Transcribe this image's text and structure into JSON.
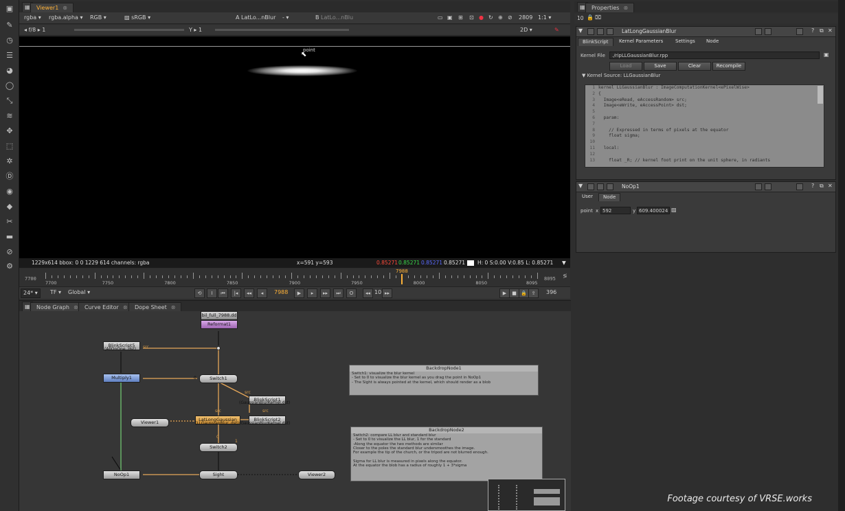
{
  "viewer": {
    "tab": "Viewer1",
    "layer": "rgba",
    "channel": "rgba.alpha",
    "display": "RGB",
    "lut": "sRGB",
    "input_a_label": "A",
    "input_a": "LatLo...nBlur",
    "input_a_op": "-",
    "input_b_label": "B",
    "input_b": "LatLo...nBlu",
    "fstop": "f/8",
    "gain": "1",
    "gamma_label": "Y",
    "gamma": "1",
    "frame_val": "2809",
    "zoom": "1:1",
    "mode": "2D",
    "point_label": "point",
    "info_format": "1229x614  bbox: 0 0 1229 614 channels: rgba",
    "info_xy": "x=591 y=593",
    "info_r": "0.85271",
    "info_g": "0.85271",
    "info_b": "0.85271",
    "info_a": "0.85271",
    "info_hsv": "H:  0 S:0.00 V:0.85  L: 0.85271",
    "colors": {
      "r": "#ff4b3a",
      "g": "#39d94a",
      "b": "#5a6bff",
      "accent": "#ffb238"
    }
  },
  "timeline": {
    "start": "7700",
    "end": "8095",
    "ticks": [
      "7700",
      "7750",
      "7800",
      "7850",
      "7900",
      "7950",
      "8000",
      "8050",
      "8095"
    ],
    "current": "7988",
    "fps": "24*",
    "tf": "TF",
    "scope": "Global",
    "current_frame": "7988",
    "step": "10",
    "end_frame": "396"
  },
  "nodegraph_tabs": [
    {
      "label": "Node Graph"
    },
    {
      "label": "Curve Editor"
    },
    {
      "label": "Dope Sheet"
    }
  ],
  "nodes": {
    "read": "bil_full_7988.dd",
    "reformat": "Reformat1",
    "blink5": "BlinkScript5",
    "blink5_sub": "(AllOnOne..dst)",
    "multiply": "Multiply1",
    "switch1": "Switch1",
    "blink1": "BlinkScript1",
    "blink1_sub": "(GaussianBlurKernel.dst)",
    "viewer1": "Viewer1",
    "latlong": "LatLongGaussian",
    "latlong_sub": "(LLGaussianBlur..dst)",
    "blink2": "BlinkScript2",
    "blink2_sub": "(GaussianBlurKernel.dst)",
    "switch2": "Switch2",
    "noop": "NoOp1",
    "sight": "Sight",
    "viewer2": "Viewer2",
    "src_label": "src",
    "zero_label": "0",
    "one_label": "1"
  },
  "backdrop1": {
    "title": "BackdropNode1",
    "lines": [
      "Switch1: visualize the blur kernel",
      "- Set to 0 to visualize the blur kernel as you drag the point in NoOp1",
      "- The Sight is always pointed at the kernel, which should render as a blob"
    ]
  },
  "backdrop2": {
    "title": "BackdropNode2",
    "lines": [
      "Switch2: compare LL blur and standard blur",
      "- Set to 0 to visualize the LL blur, 1 for the standard",
      "-Along the equator the two methods are similar",
      "Closer to the poles the standard blur undersmoothes the image.",
      "For example the tip of the church, or the tripod are not blurred enough.",
      "",
      "Sigma for LL blur is measured in pixels along the equator.",
      "At the equator the blob has a radius of roughly 1 + 3*sigma"
    ]
  },
  "properties": {
    "tab": "Properties",
    "count": "10",
    "panel1": {
      "name": "LatLongGaussianBlur",
      "tabs": [
        "BlinkScript",
        "Kernel Parameters",
        "Settings",
        "Node"
      ],
      "kernel_file_label": "Kernel File",
      "kernel_file": "./ripLLGaussianBlur.rpp",
      "buttons": [
        "Load",
        "Save",
        "Clear",
        "Recompile"
      ],
      "kernel_source_label": "Kernel Source: LLGaussianBlur",
      "code": [
        {
          "n": "1",
          "t": "kernel LLGaussianBlur : ImageComputationKernel<ePixelWise>"
        },
        {
          "n": "2",
          "t": "{"
        },
        {
          "n": "3",
          "t": "  Image<eRead, eAccessRandom> src;"
        },
        {
          "n": "4",
          "t": "  Image<eWrite, eAccessPoint> dst;"
        },
        {
          "n": "5",
          "t": ""
        },
        {
          "n": "6",
          "t": "  param:"
        },
        {
          "n": "7",
          "t": ""
        },
        {
          "n": "8",
          "t": "    // Expressed in terms of pixels at the equator"
        },
        {
          "n": "9",
          "t": "    float sigma;"
        },
        {
          "n": "10",
          "t": ""
        },
        {
          "n": "11",
          "t": "  local:"
        },
        {
          "n": "12",
          "t": ""
        },
        {
          "n": "13",
          "t": "    float _R; // kernel foot print on the unit sphere, in radiants"
        }
      ]
    },
    "panel2": {
      "name": "NoOp1",
      "tabs": [
        "User",
        "Node"
      ],
      "point_label": "point",
      "x_label": "x",
      "x_value": "592",
      "y_label": "y",
      "y_value": "609.400024"
    }
  },
  "credit": "Footage courtesy of VRSE.works"
}
